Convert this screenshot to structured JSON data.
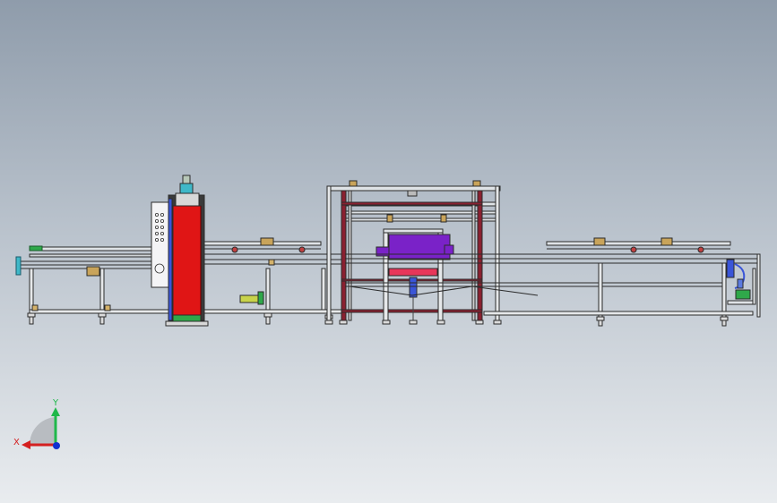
{
  "triad": {
    "x_label": "X",
    "y_label": "Y",
    "x_color": "#d42020",
    "y_color": "#1fb84a",
    "z_color": "#1030d0"
  },
  "colors": {
    "frame": "#2b2b2b",
    "red_column": "#e01515",
    "purple_block": "#7a22c8",
    "pink_plate": "#e8365a",
    "blue_cylinder": "#3a55d8",
    "maroon_frame": "#8a2030",
    "green_accent": "#2fa84a",
    "panel_white": "#f4f4f6"
  }
}
